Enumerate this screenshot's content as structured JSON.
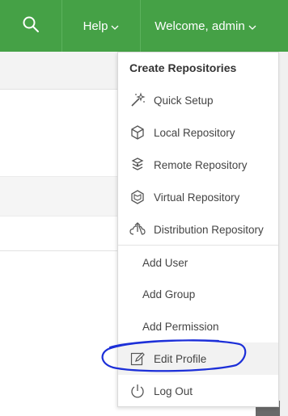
{
  "topbar": {
    "search_icon": "search-icon",
    "help_label": "Help",
    "welcome_label": "Welcome, admin",
    "chevron": "⌵"
  },
  "dropdown": {
    "header": "Create Repositories",
    "repo_items": [
      {
        "label": "Quick Setup",
        "icon": "magic-wand-icon"
      },
      {
        "label": "Local Repository",
        "icon": "cube-icon"
      },
      {
        "label": "Remote Repository",
        "icon": "stack-icon"
      },
      {
        "label": "Virtual Repository",
        "icon": "virtual-cube-icon"
      },
      {
        "label": "Distribution Repository",
        "icon": "cloud-upload-icon"
      }
    ],
    "admin_items": [
      {
        "label": "Add User"
      },
      {
        "label": "Add Group"
      },
      {
        "label": "Add Permission"
      }
    ],
    "profile_items": [
      {
        "label": "Edit Profile",
        "icon": "edit-icon"
      },
      {
        "label": "Log Out",
        "icon": "power-icon"
      }
    ]
  },
  "colors": {
    "topbar": "#45a146",
    "annotation": "#1c2fd8"
  }
}
